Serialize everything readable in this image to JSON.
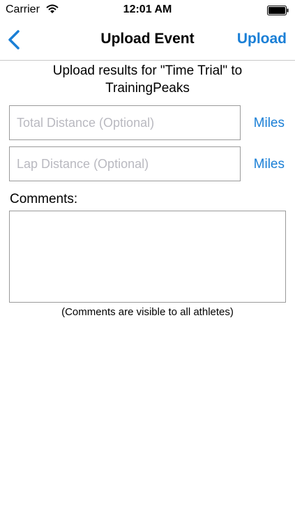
{
  "status_bar": {
    "carrier": "Carrier",
    "time": "12:01 AM",
    "wifi_icon": "wifi-icon",
    "battery_icon": "battery-icon"
  },
  "nav": {
    "title": "Upload Event",
    "upload_label": "Upload",
    "back_icon": "chevron-left-icon"
  },
  "intro_text": "Upload results for \"Time Trial\" to TrainingPeaks",
  "fields": {
    "total_distance": {
      "placeholder": "Total Distance (Optional)",
      "value": "",
      "unit": "Miles"
    },
    "lap_distance": {
      "placeholder": "Lap Distance (Optional)",
      "value": "",
      "unit": "Miles"
    }
  },
  "comments": {
    "label": "Comments:",
    "value": "",
    "note": "(Comments are visible to all athletes)"
  },
  "colors": {
    "accent": "#1a7fd6"
  }
}
